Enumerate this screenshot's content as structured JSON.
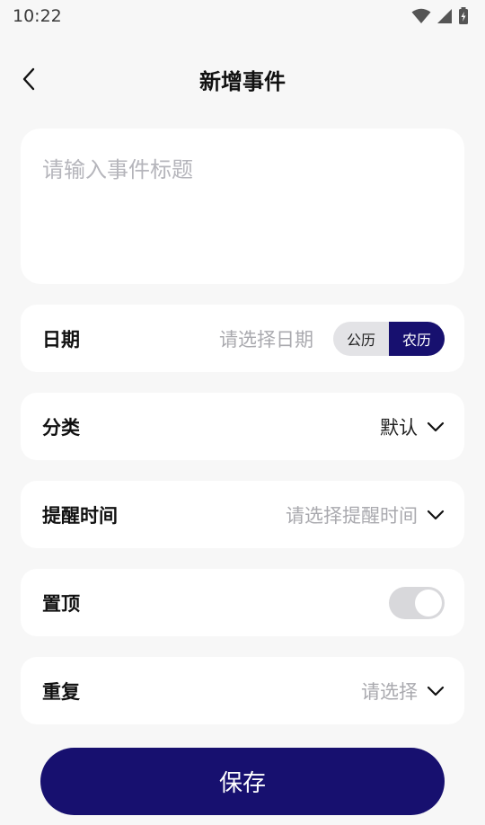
{
  "status_bar": {
    "time": "10:22"
  },
  "header": {
    "title": "新增事件"
  },
  "title_input": {
    "placeholder": "请输入事件标题",
    "value": ""
  },
  "date_row": {
    "label": "日期",
    "placeholder": "请选择日期",
    "calendar_options": [
      "公历",
      "农历"
    ],
    "selected_calendar": "农历"
  },
  "category_row": {
    "label": "分类",
    "value": "默认"
  },
  "reminder_row": {
    "label": "提醒时间",
    "placeholder": "请选择提醒时间"
  },
  "pin_row": {
    "label": "置顶",
    "enabled": false
  },
  "repeat_row": {
    "label": "重复",
    "placeholder": "请选择"
  },
  "save_button": {
    "label": "保存"
  },
  "colors": {
    "accent": "#17106f",
    "background": "#f7f7f7",
    "placeholder": "#a9a9ae"
  }
}
